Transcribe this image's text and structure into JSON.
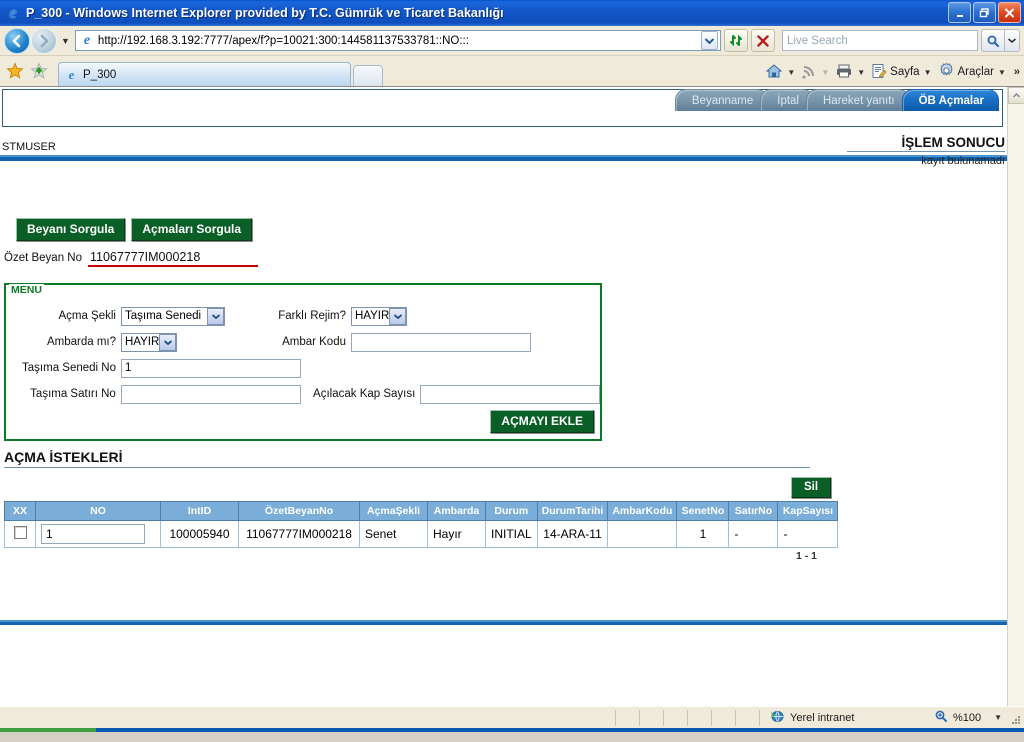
{
  "window": {
    "title": "P_300 - Windows Internet Explorer provided by T.C. Gümrük ve Ticaret Bakanlığı",
    "minimize_label": "minimize-icon",
    "restore_label": "restore-icon",
    "close_label": "close-icon"
  },
  "address_bar": {
    "url": "http://192.168.3.192:7777/apex/f?p=10021:300:144581137533781::NO:::",
    "back_label": "back-icon",
    "forward_label": "forward-icon",
    "refresh_label": "refresh-icon",
    "stop_label": "stop-icon",
    "search_placeholder": "Live Search",
    "search_value": "",
    "search_go_label": "search-icon"
  },
  "browser_tabs": {
    "favorites_label": "favorites-star-icon",
    "add_favorite_label": "add-favorite-icon",
    "tabs": [
      {
        "label": "P_300",
        "active": true
      }
    ],
    "new_tab_label": "new-tab"
  },
  "command_bar": {
    "items": [
      {
        "name": "home",
        "label": "",
        "icon": "home-icon",
        "has_caret": true
      },
      {
        "name": "feeds",
        "label": "",
        "icon": "rss-icon",
        "has_caret": true
      },
      {
        "name": "print",
        "label": "",
        "icon": "printer-icon",
        "has_caret": true
      },
      {
        "name": "page",
        "label": "Sayfa",
        "icon": "page-icon",
        "has_caret": true
      },
      {
        "name": "tools",
        "label": "Araçlar",
        "icon": "gear-icon",
        "has_caret": true
      }
    ],
    "overflow_label": "»"
  },
  "app": {
    "user": "STMUSER",
    "tabs": [
      {
        "label": "Beyanname",
        "active": false
      },
      {
        "label": "İptal",
        "active": false
      },
      {
        "label": "Hareket yanıtı",
        "active": false
      },
      {
        "label": "ÖB Açmalar",
        "active": true
      }
    ],
    "result_panel": {
      "title": "İŞLEM SONUCU",
      "message": "kayıt bulunamadı"
    },
    "actions": {
      "query_declaration": "Beyanı Sorgula",
      "query_openings": "Açmaları Sorgula",
      "add_opening": "AÇMAYI EKLE",
      "delete": "Sil"
    },
    "summary_declaration": {
      "label": "Özet Beyan No",
      "value": "11067777IM000218"
    },
    "menu": {
      "legend": "MENU",
      "fields": [
        {
          "label": "Açma Şekli",
          "type": "select",
          "value": "Taşıma Senedi",
          "name": "acma-sekli-select"
        },
        {
          "label": "Farklı Rejim?",
          "type": "select",
          "value": "HAYIR",
          "name": "farkli-rejim-select"
        },
        {
          "label": "Ambarda mı?",
          "type": "select",
          "value": "HAYIR",
          "name": "ambarda-mi-select"
        },
        {
          "label": "Ambar Kodu",
          "type": "text",
          "value": "",
          "name": "ambar-kodu-input"
        },
        {
          "label": "Taşıma Senedi No",
          "type": "text",
          "value": "1",
          "name": "tasima-senedi-no-input"
        },
        {
          "label": "Taşıma Satırı No",
          "type": "text",
          "value": "",
          "name": "tasima-satiri-no-input"
        },
        {
          "label": "Açılacak Kap Sayısı",
          "type": "text",
          "value": "",
          "name": "acilacak-kap-sayisi-input"
        }
      ]
    },
    "requests_section": {
      "title": "AÇMA İSTEKLERİ",
      "columns": [
        "XX",
        "NO",
        "IntID",
        "ÖzetBeyanNo",
        "AçmaŞekli",
        "Ambarda",
        "Durum",
        "DurumTarihi",
        "AmbarKodu",
        "SenetNo",
        "SatırNo",
        "KapSayısı"
      ],
      "rows": [
        {
          "checked": false,
          "no": "1",
          "int_id": "100005940",
          "ozet_beyan_no": "11067777IM000218",
          "acma_sekli": "Senet",
          "ambarda": "Hayır",
          "durum": "INITIAL",
          "durum_tarihi": "14-ARA-11",
          "ambar_kodu": "",
          "senet_no": "1",
          "satir_no": "-",
          "kap_sayisi": "-"
        }
      ],
      "pagination": "1 - 1"
    }
  },
  "status_bar": {
    "zone": "Yerel intranet",
    "zone_icon": "intranet-icon",
    "zoom": "%100",
    "zoom_icon": "zoom-icon"
  }
}
